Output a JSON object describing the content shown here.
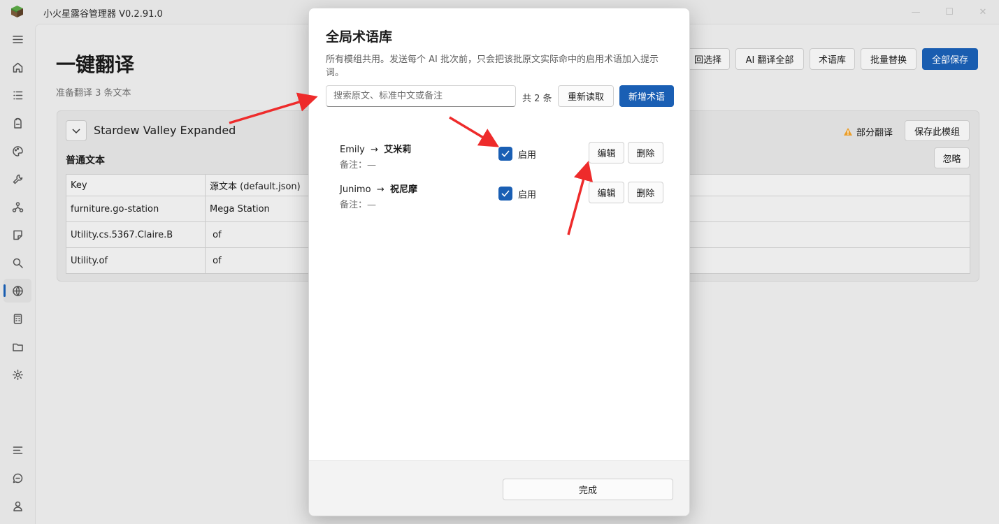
{
  "app": {
    "title": "小火星露谷管理器 V0.2.91.0"
  },
  "page": {
    "title": "一键翻译",
    "subtitle": "准备翻译 3 条文本"
  },
  "toolbar": {
    "back_select": "回选择",
    "ai_translate_all": "AI 翻译全部",
    "glossary": "术语库",
    "batch_replace": "批量替换",
    "save_all": "全部保存"
  },
  "mod_card": {
    "name": "Stardew Valley Expanded",
    "status": "部分翻译",
    "save_mod": "保存此模组",
    "section_title": "普通文本",
    "ignore": "忽略",
    "columns": [
      "Key",
      "源文本 (default.json)"
    ],
    "rows": [
      [
        "furniture.go-station",
        "Mega Station"
      ],
      [
        "Utility.cs.5367.Claire.B",
        " of"
      ],
      [
        "Utility.of",
        " of"
      ]
    ]
  },
  "dialog": {
    "title": "全局术语库",
    "description": "所有模组共用。发送每个 AI 批次前，只会把该批原文实际命中的启用术语加入提示词。",
    "search_placeholder": "搜索原文、标准中文或备注",
    "count": "共 2 条",
    "reload": "重新读取",
    "add": "新增术语",
    "terms": [
      {
        "source": "Emily",
        "arrow": "→",
        "target": "艾米莉",
        "note": "备注：—",
        "enabled_label": "启用",
        "enabled": true,
        "edit": "编辑",
        "delete": "删除"
      },
      {
        "source": "Junimo",
        "arrow": "→",
        "target": "祝尼摩",
        "note": "备注：—",
        "enabled_label": "启用",
        "enabled": true,
        "edit": "编辑",
        "delete": "删除"
      }
    ],
    "done": "完成"
  },
  "colors": {
    "accent": "#1a5fb4",
    "annotation_arrow": "#ee2b2b"
  }
}
